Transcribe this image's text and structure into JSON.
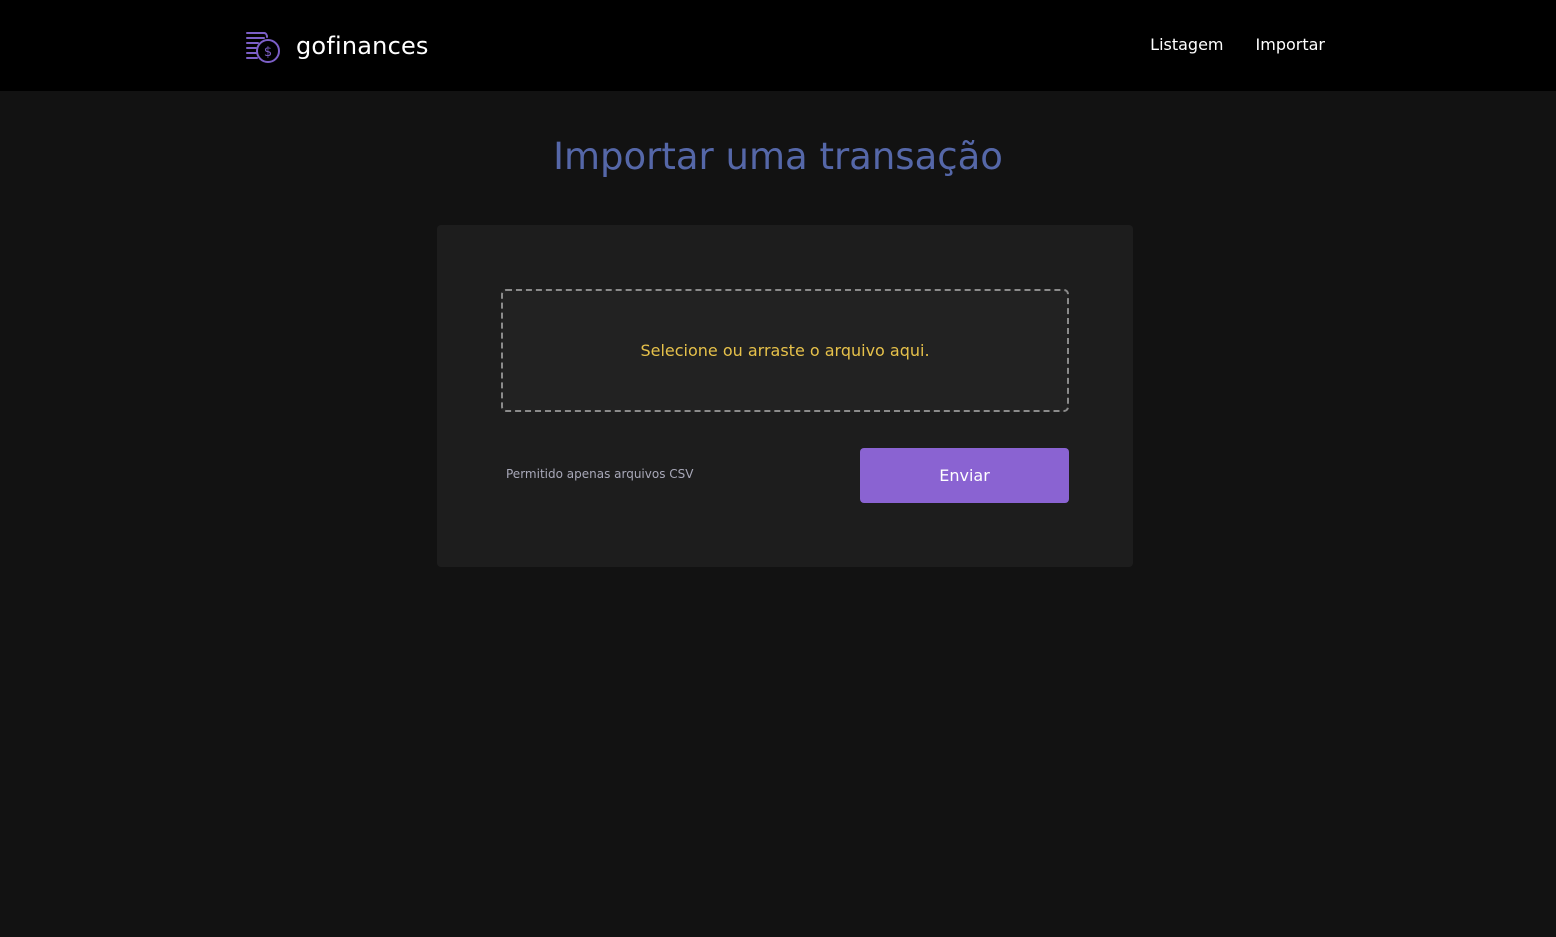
{
  "header": {
    "brand": "gofinances",
    "logo_icon": "coin-stack-dollar-icon",
    "nav": [
      {
        "label": "Listagem"
      },
      {
        "label": "Importar"
      }
    ]
  },
  "main": {
    "title": "Importar uma transação",
    "dropzone": {
      "text": "Selecione ou arraste o arquivo aqui."
    },
    "help_text": "Permitido apenas arquivos CSV",
    "submit_label": "Enviar"
  },
  "colors": {
    "header_bg": "#000000",
    "page_bg": "#121212",
    "card_bg": "#1d1d1d",
    "title": "#5567a8",
    "dropzone_text": "#e6c14a",
    "button": "#8a63d2"
  }
}
